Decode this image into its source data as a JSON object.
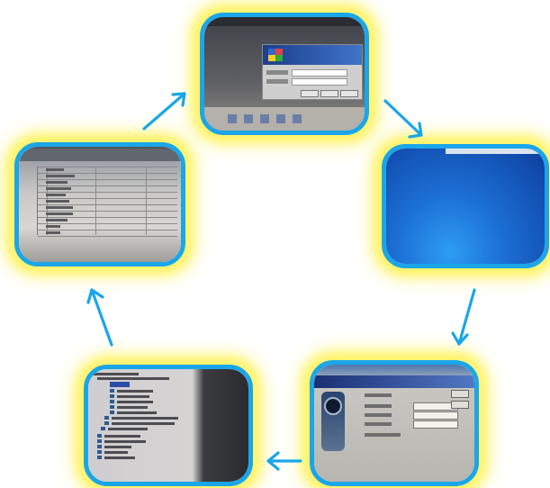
{
  "diagram": {
    "type": "cycle",
    "colors": {
      "frame_border": "#1aa6e8",
      "frame_glow": "#fff36a",
      "arrow": "#1aa6e8"
    },
    "nodes": [
      {
        "id": "windows-server-login",
        "icon": "windows-login-screenshot"
      },
      {
        "id": "blue-desktop",
        "icon": "desktop-screenshot"
      },
      {
        "id": "application-logon-dialog",
        "icon": "logon-dialog-screenshot"
      },
      {
        "id": "definitions-tree",
        "icon": "tree-view-screenshot"
      },
      {
        "id": "data-table",
        "icon": "table-screenshot"
      }
    ],
    "edges": [
      {
        "from": "windows-server-login",
        "to": "blue-desktop"
      },
      {
        "from": "blue-desktop",
        "to": "application-logon-dialog"
      },
      {
        "from": "application-logon-dialog",
        "to": "definitions-tree"
      },
      {
        "from": "definitions-tree",
        "to": "data-table"
      },
      {
        "from": "data-table",
        "to": "windows-server-login"
      }
    ]
  }
}
